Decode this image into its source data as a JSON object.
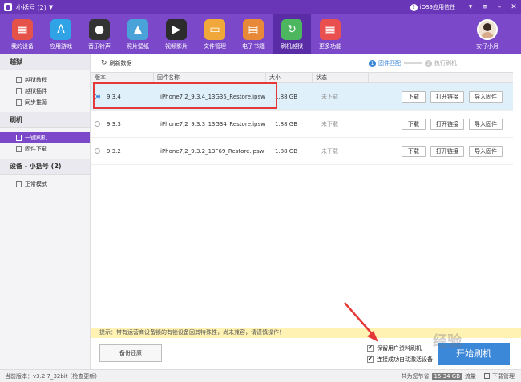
{
  "titlebar": {
    "title": "小括号 (2)",
    "dropdown": "▼",
    "trust_label": "iOS9应用信任",
    "trust_icon": "!"
  },
  "toolbar": {
    "items": [
      {
        "label": "我的设备",
        "icon": "store-icon",
        "color": "#e5524a"
      },
      {
        "label": "应用游戏",
        "icon": "appstore-icon",
        "color": "#2fa3e6"
      },
      {
        "label": "音乐铃声",
        "icon": "music-icon",
        "color": "#333333"
      },
      {
        "label": "照片壁纸",
        "icon": "photo-icon",
        "color": "#4aa3d8"
      },
      {
        "label": "视频影片",
        "icon": "video-icon",
        "color": "#2c2c2c"
      },
      {
        "label": "文件管理",
        "icon": "folder-icon",
        "color": "#f0a83a"
      },
      {
        "label": "电子书籍",
        "icon": "book-icon",
        "color": "#e8893a"
      },
      {
        "label": "刷机越狱",
        "icon": "refresh-icon",
        "color": "#4cb75f"
      },
      {
        "label": "更多功能",
        "icon": "grid-icon",
        "color": "#e94f4f"
      }
    ],
    "user_label": "安仔小月"
  },
  "sidebar": {
    "sections": [
      {
        "title": "越狱",
        "items": [
          "越狱教程",
          "越狱插件",
          "同步推源"
        ]
      },
      {
        "title": "刷机",
        "items": [
          "一键刷机",
          "固件下载"
        ]
      },
      {
        "title": "设备 - 小括号 (2)",
        "items": [
          "正常模式"
        ]
      }
    ],
    "active_item": "一键刷机"
  },
  "main": {
    "refresh_label": "刷新数据",
    "steps": [
      {
        "num": "1",
        "label": "固件匹配"
      },
      {
        "num": "2",
        "label": "执行刷机"
      }
    ],
    "columns": [
      "版本",
      "固件名称",
      "大小",
      "状态"
    ],
    "rows": [
      {
        "version": "9.3.4",
        "name": "iPhone7,2_9.3.4_13G35_Restore.ipsw",
        "size": "1.88 GB",
        "status": "未下载",
        "selected": true
      },
      {
        "version": "9.3.3",
        "name": "iPhone7,2_9.3.3_13G34_Restore.ipsw",
        "size": "1.88 GB",
        "status": "未下载",
        "selected": false
      },
      {
        "version": "9.3.2",
        "name": "iPhone7,2_9.3.2_13F69_Restore.ipsw",
        "size": "1.88 GB",
        "status": "未下载",
        "selected": false
      }
    ],
    "row_buttons": {
      "download": "下载",
      "open_link": "打开链接",
      "import": "导入固件"
    },
    "hint": "提示：带有运营商设备锁的有锁设备因其特殊性，尚未兼容，请谨慎操作！",
    "backup_label": "备份还原",
    "keep_data_label": "保留用户资料刷机",
    "auto_activate_label": "连接成功自动激活设备",
    "start_label": "开始刷机"
  },
  "statusbar": {
    "version": "当前版本：v3.2.7_32bit",
    "update": "(检查更新)",
    "saved_prefix": "共为您节省",
    "saved_value": "15.34 GB",
    "saved_suffix": "流量",
    "download_manager": "下载管理"
  },
  "watermark": "经验"
}
